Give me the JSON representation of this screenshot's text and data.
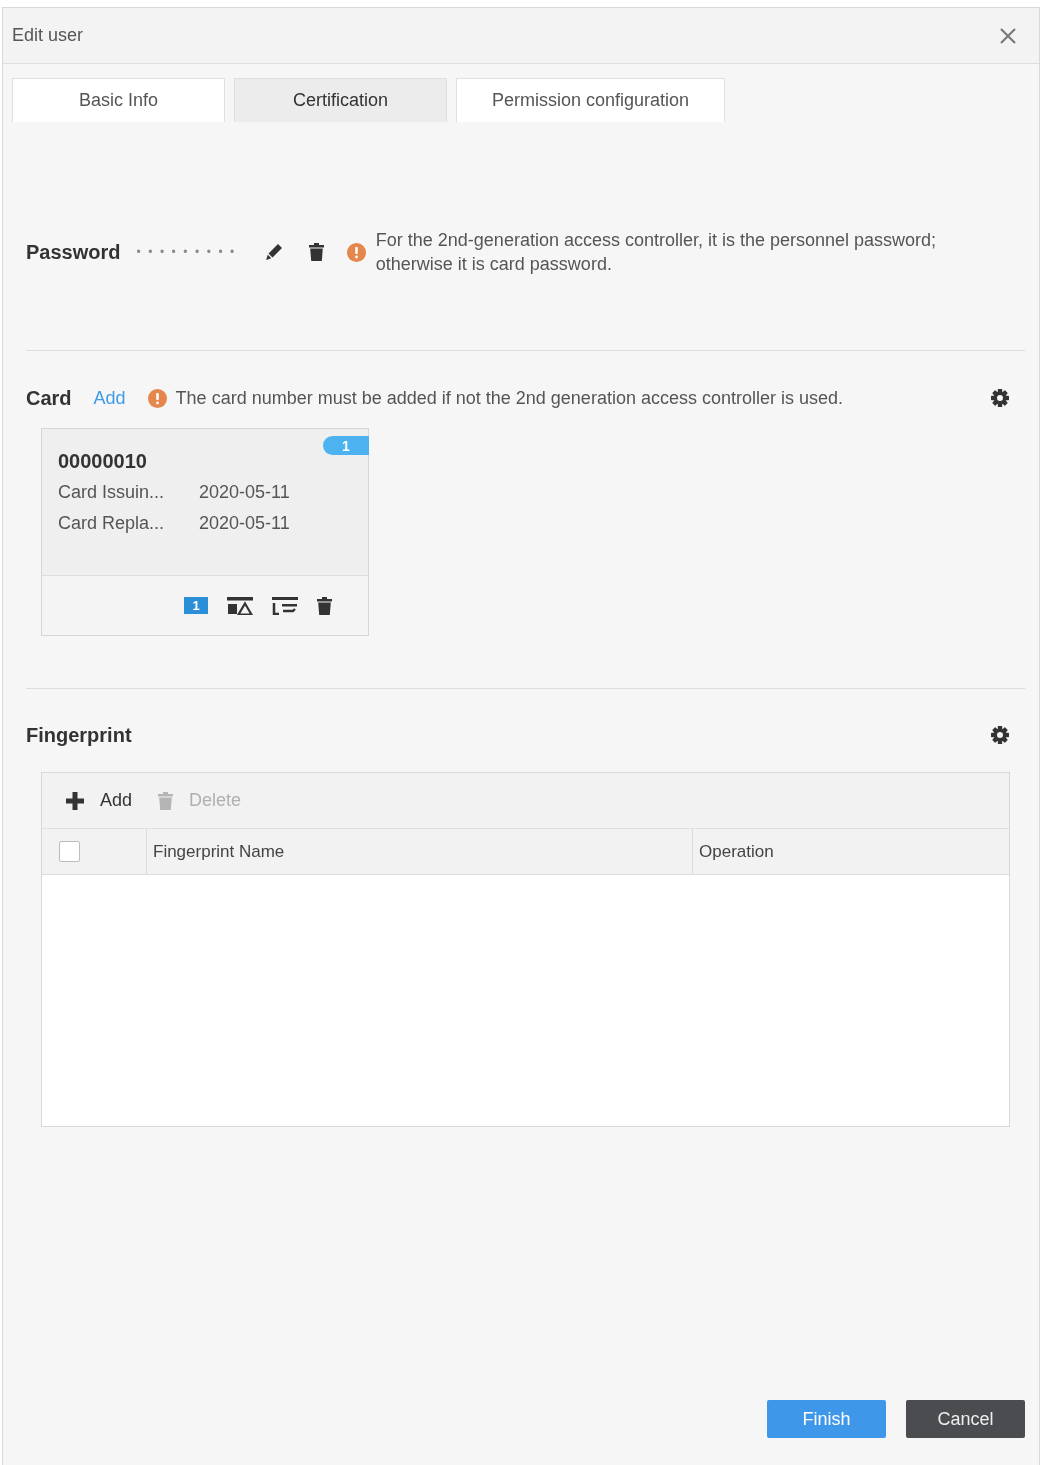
{
  "window": {
    "title": "Edit user"
  },
  "tabs": [
    {
      "label": "Basic Info",
      "selected": false
    },
    {
      "label": "Certification",
      "selected": true
    },
    {
      "label": "Permission configuration",
      "selected": false
    }
  ],
  "password": {
    "label": "Password",
    "value": "•••••••••",
    "note": "For the 2nd-generation access controller, it is the personnel password; otherwise it is card password."
  },
  "card": {
    "label": "Card",
    "add_link": "Add",
    "note": "The card number must be added if not the 2nd generation access controller is used.",
    "items": [
      {
        "badge": "1",
        "number": "00000010",
        "fields": [
          {
            "label": "Card Issuin...",
            "value": "2020-05-11"
          },
          {
            "label": "Card Repla...",
            "value": "2020-05-11"
          }
        ],
        "tag": "1"
      }
    ]
  },
  "fingerprint": {
    "label": "Fingerprint",
    "toolbar": [
      {
        "kind": "add",
        "label": "Add",
        "disabled": false
      },
      {
        "kind": "delete",
        "label": "Delete",
        "disabled": true
      }
    ],
    "select_all": {
      "checked": false
    },
    "columns": [
      "Fingerprint Name",
      "Operation"
    ]
  },
  "buttons": [
    {
      "kind": "primary",
      "label": "Finish"
    },
    {
      "kind": "secondary",
      "label": "Cancel"
    }
  ]
}
